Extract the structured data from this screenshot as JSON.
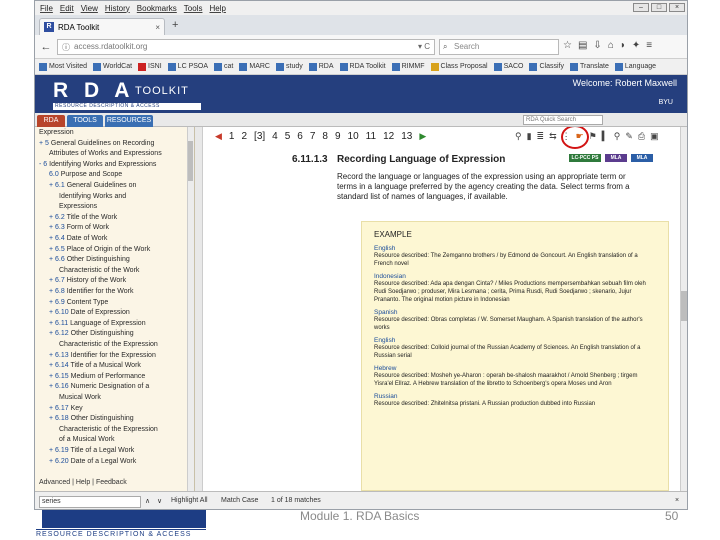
{
  "browser": {
    "menu": [
      "File",
      "Edit",
      "View",
      "History",
      "Bookmarks",
      "Tools",
      "Help"
    ],
    "tab_title": "RDA Toolkit",
    "new_tab": "+",
    "url": "access.rdatoolkit.org",
    "search_placeholder": "Search",
    "bookmarks": [
      "Most Visited",
      "WorldCat",
      "ISNI",
      "LC PSOA",
      "cat",
      "MARC",
      "study",
      "RDA",
      "RDA Toolkit",
      "RIMMF",
      "Class Proposal",
      "SACO",
      "Classify",
      "Translate",
      "Language"
    ]
  },
  "rda_header": {
    "logo": "R D A",
    "logo_sub": "TOOLKIT",
    "strapline": "RESOURCE DESCRIPTION & ACCESS",
    "welcome": "Welcome: Robert Maxwell",
    "sub": "BYU"
  },
  "tabs": [
    "RDA",
    "TOOLS",
    "RESOURCES"
  ],
  "quick_search_placeholder": "RDA Quick Search",
  "toc": {
    "items": [
      {
        "no": "",
        "label": "Expression",
        "indent": 0
      },
      {
        "no": "+ 5",
        "label": "General Guidelines on Recording",
        "indent": 0
      },
      {
        "no": "",
        "label": "Attributes of Works and Expressions",
        "indent": 1
      },
      {
        "no": "- 6",
        "label": "Identifying Works and Expressions",
        "indent": 0
      },
      {
        "no": "6.0",
        "label": "Purpose and Scope",
        "indent": 1
      },
      {
        "no": "+ 6.1",
        "label": "General Guidelines on",
        "indent": 1
      },
      {
        "no": "",
        "label": "Identifying Works and",
        "indent": 2
      },
      {
        "no": "",
        "label": "Expressions",
        "indent": 2
      },
      {
        "no": "+ 6.2",
        "label": "Title of the Work",
        "indent": 1
      },
      {
        "no": "+ 6.3",
        "label": "Form of Work",
        "indent": 1
      },
      {
        "no": "+ 6.4",
        "label": "Date of Work",
        "indent": 1
      },
      {
        "no": "+ 6.5",
        "label": "Place of Origin of the Work",
        "indent": 1
      },
      {
        "no": "+ 6.6",
        "label": "Other Distinguishing",
        "indent": 1
      },
      {
        "no": "",
        "label": "Characteristic of the Work",
        "indent": 2
      },
      {
        "no": "+ 6.7",
        "label": "History of the Work",
        "indent": 1
      },
      {
        "no": "+ 6.8",
        "label": "Identifier for the Work",
        "indent": 1
      },
      {
        "no": "+ 6.9",
        "label": "Content Type",
        "indent": 1
      },
      {
        "no": "+ 6.10",
        "label": "Date of Expression",
        "indent": 1
      },
      {
        "no": "+ 6.11",
        "label": "Language of Expression",
        "indent": 1
      },
      {
        "no": "+ 6.12",
        "label": "Other Distinguishing",
        "indent": 1
      },
      {
        "no": "",
        "label": "Characteristic of the Expression",
        "indent": 2
      },
      {
        "no": "+ 6.13",
        "label": "Identifier for the Expression",
        "indent": 1
      },
      {
        "no": "+ 6.14",
        "label": "Title of a Musical Work",
        "indent": 1
      },
      {
        "no": "+ 6.15",
        "label": "Medium of Performance",
        "indent": 1
      },
      {
        "no": "+ 6.16",
        "label": "Numeric Designation of a",
        "indent": 1
      },
      {
        "no": "",
        "label": "Musical Work",
        "indent": 2
      },
      {
        "no": "+ 6.17",
        "label": "Key",
        "indent": 1
      },
      {
        "no": "+ 6.18",
        "label": "Other Distinguishing",
        "indent": 1
      },
      {
        "no": "",
        "label": "Characteristic of the Expression",
        "indent": 2
      },
      {
        "no": "",
        "label": "of a Musical Work",
        "indent": 2
      },
      {
        "no": "+ 6.19",
        "label": "Title of a Legal Work",
        "indent": 1
      },
      {
        "no": "+ 6.20",
        "label": "Date of a Legal Work",
        "indent": 1
      }
    ],
    "footer": "Advanced | Help | Feedback"
  },
  "pager": {
    "pages": [
      "1",
      "2",
      "[3]",
      "4",
      "5",
      "6",
      "7",
      "8",
      "9",
      "10",
      "11",
      "12",
      "13"
    ]
  },
  "section": {
    "number": "6.11.1.3",
    "title": "Recording Language of Expression",
    "badges": [
      "LC-PCC PS",
      "MLA",
      "MLA"
    ],
    "instruction": "Record the language or languages of the expression using an appropriate term or terms in a language preferred by the agency creating the data. Select terms from a standard list of names of languages, if available."
  },
  "example": {
    "heading": "EXAMPLE",
    "entries": [
      {
        "language": "English",
        "text": "Resource described: The Zemganno brothers / by Edmond de Goncourt. An English translation of a French novel"
      },
      {
        "language": "Indonesian",
        "text": "Resource described: Ada apa dengan Cinta? / Miles Productions mempersembahkan sebuah film oleh Rudi Soedjarwo ; produser, Mira Lesmana ; cerita, Prima Rusdi, Rudi Soedjarwo ; skenario, Jujur Prananto. The original motion picture in Indonesian"
      },
      {
        "language": "Spanish",
        "text": "Resource described: Obras completas / W. Somerset Maugham. A Spanish translation of the author's works"
      },
      {
        "language": "English",
        "text": "Resource described: Colloid journal of the Russian Academy of Sciences. An English translation of a Russian serial"
      },
      {
        "language": "Hebrew",
        "text": "Resource described: Mosheh ye-Aharon : operah be-shalosh maarakhot / Arnold Shenberg ; tirgem Yisra'el Ellraz. A Hebrew translation of the libretto to Schoenberg's opera Moses und Aron"
      },
      {
        "language": "Russian",
        "text": "Resource described: Zhitelnitsa pristani. A Russian production dubbed into Russian"
      }
    ]
  },
  "findbar": {
    "query": "series",
    "highlight_all": "Highlight All",
    "match_case": "Match Case",
    "count": "1 of 18 matches"
  },
  "slide": {
    "logo_strap": "RESOURCE DESCRIPTION & ACCESS",
    "module": "Module 1. RDA Basics",
    "page": "50"
  },
  "colors": {
    "rda_blue": "#253f7e",
    "highlight_circle": "#d21414",
    "example_bg": "#fdf7d3",
    "toc_bg": "#fbf5e6"
  }
}
